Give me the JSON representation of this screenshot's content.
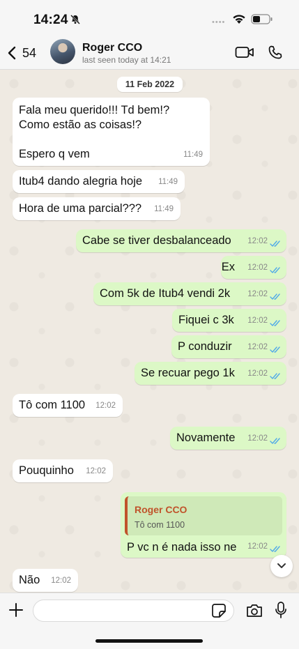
{
  "status_bar": {
    "time": "14:24"
  },
  "header": {
    "back_count": "54",
    "contact_name": "Roger CCO",
    "contact_status": "last seen today at 14:21"
  },
  "chat": {
    "date_chip": "11 Feb 2022",
    "messages": [
      {
        "dir": "in",
        "text": "Fala meu querido!!! Td bem!?\nComo estão as coisas!?\n\nEspero q vem",
        "time": "11:49"
      },
      {
        "dir": "in",
        "text": "Itub4 dando alegria hoje",
        "time": "11:49"
      },
      {
        "dir": "in",
        "text": "Hora de uma parcial???",
        "time": "11:49"
      },
      {
        "dir": "out",
        "text": "Cabe se tiver desbalanceado",
        "time": "12:02"
      },
      {
        "dir": "out",
        "text": "Ex",
        "time": "12:02"
      },
      {
        "dir": "out",
        "text": "Com 5k de Itub4 vendi 2k",
        "time": "12:02"
      },
      {
        "dir": "out",
        "text": "Fiquei c 3k",
        "time": "12:02"
      },
      {
        "dir": "out",
        "text": "P conduzir",
        "time": "12:02"
      },
      {
        "dir": "out",
        "text": "Se recuar pego 1k",
        "time": "12:02"
      },
      {
        "dir": "in",
        "text": "Tô com 1100",
        "time": "12:02"
      },
      {
        "dir": "out",
        "text": "Novamente",
        "time": "12:02"
      },
      {
        "dir": "in",
        "text": "Pouquinho",
        "time": "12:02"
      },
      {
        "dir": "out",
        "text": "P vc n é nada isso ne",
        "time": "12:02",
        "quote": {
          "name": "Roger CCO",
          "text": "Tô com 1100"
        }
      },
      {
        "dir": "in",
        "text": "Não",
        "time": "12:02"
      }
    ]
  },
  "input": {
    "placeholder": ""
  },
  "colors": {
    "outgoing": "#dcf8c6",
    "incoming": "#ffffff",
    "read_ticks": "#4fa9e8",
    "quote_accent": "#c0532b"
  }
}
